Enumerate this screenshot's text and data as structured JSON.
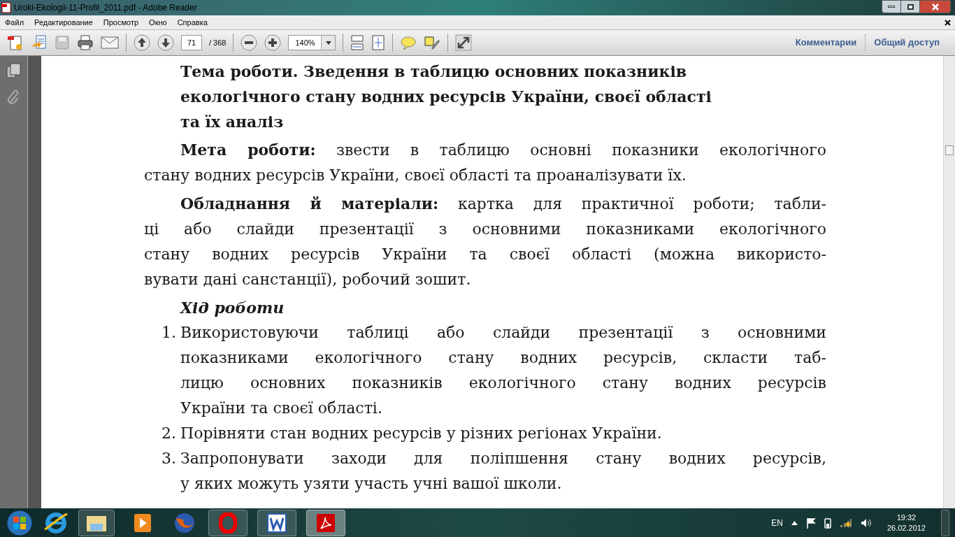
{
  "window": {
    "title": "Uroki-Ekologii-11-Profil_2011.pdf - Adobe Reader"
  },
  "menu": [
    "Файл",
    "Редактирование",
    "Просмотр",
    "Окно",
    "Справка"
  ],
  "toolbar": {
    "page_number": "71",
    "page_total": "/ 368",
    "zoom": "140%",
    "links": [
      "Комментарии",
      "Общий доступ"
    ]
  },
  "document": {
    "heading": [
      "Тема роботи. Зведення в таблицю основних показників",
      "екологічного стану водних ресурсів України, своєї області",
      "та їх аналіз"
    ],
    "paragraphs": [
      {
        "lines": [
          "**Мета роботи:** звести в таблицю основні показники екологічного",
          "стану водних ресурсів України, своєї області та проаналізувати їх."
        ]
      },
      {
        "lines": [
          "**Обладнання й матеріали:** картка для практичної роботи; табли-",
          "ці або слайди презентації з основними показниками екологічного",
          "стану водних ресурсів України та своєї області (можна використо-",
          "вувати дані санстанції), робочий зошит."
        ]
      }
    ],
    "procedure_title": "Хід роботи",
    "steps": [
      {
        "number": "1.",
        "lines": [
          "Використовуючи таблиці або слайди презентації з основними",
          "показниками екологічного стану водних ресурсів, скласти таб-",
          "лицю основних показників екологічного стану водних ресурсів",
          "України та своєї області."
        ]
      },
      {
        "number": "2.",
        "lines": [
          "Порівняти стан водних ресурсів у різних регіонах України."
        ]
      },
      {
        "number": "3.",
        "lines": [
          "Запропонувати заходи для поліпшення стану водних ресурсів,",
          "у яких можуть узяти участь учні вашої школи."
        ]
      }
    ]
  },
  "taskbar": {
    "language": "EN",
    "time": "19:32",
    "date": "26.02.2012"
  }
}
